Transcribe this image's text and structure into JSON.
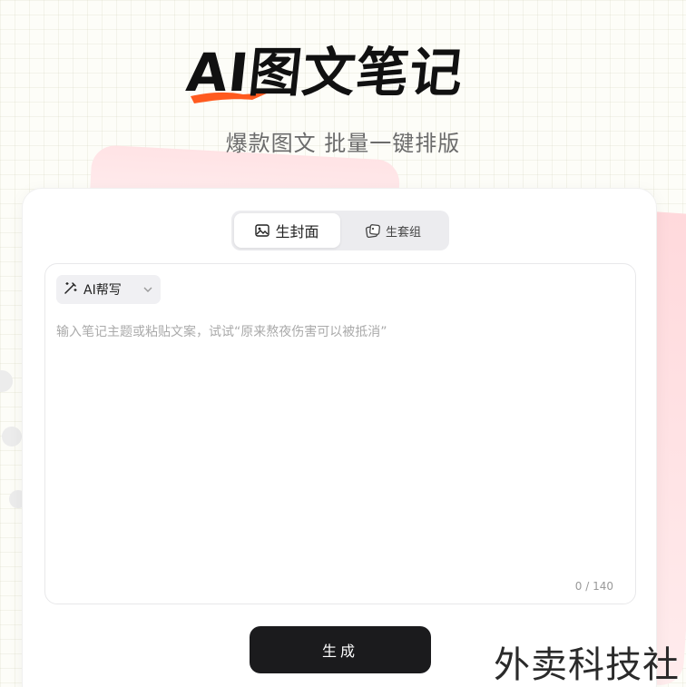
{
  "logo": {
    "text": "AI图文笔记",
    "accent_color": "#ff5a1f"
  },
  "tagline": "爆款图文 批量一键排版",
  "tabs": [
    {
      "label": "生封面",
      "icon": "image-icon",
      "active": true
    },
    {
      "label": "生套组",
      "icon": "images-icon",
      "active": false
    }
  ],
  "editor": {
    "ai_assist_label": "AI帮写",
    "placeholder": "输入笔记主题或粘贴文案，试试“原来熬夜伤害可以被抵消”",
    "value": "",
    "counter": "0 / 140"
  },
  "generate_label": "生成",
  "watermark": "外卖科技社"
}
